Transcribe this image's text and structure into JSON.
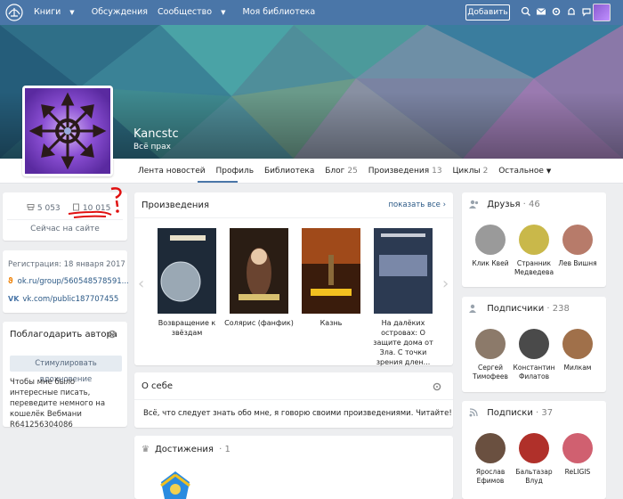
{
  "topbar": {
    "menu": [
      "Книги",
      "Обсуждения",
      "Сообщество",
      "Моя библиотека"
    ],
    "add_button": "Добавить",
    "icons": [
      "search-icon",
      "mail-icon",
      "settings-icon",
      "bell-icon",
      "chat-icon"
    ]
  },
  "profile": {
    "name": "Kancstc",
    "status": "Всё прах",
    "tabs": [
      {
        "label": "Лента новостей",
        "count": ""
      },
      {
        "label": "Профиль",
        "count": ""
      },
      {
        "label": "Библиотека",
        "count": ""
      },
      {
        "label": "Блог",
        "count": "25"
      },
      {
        "label": "Произведения",
        "count": "13"
      },
      {
        "label": "Циклы",
        "count": "2"
      },
      {
        "label": "Остальное",
        "count": ""
      }
    ]
  },
  "stats": {
    "likes": "5 053",
    "views": "10 015",
    "online": "Сейчас на сайте"
  },
  "info": {
    "registration": "Регистрация: 18 января 2017",
    "ok_link": "ok.ru/group/560548578591...",
    "vk_link": "vk.com/public187707455"
  },
  "thank": {
    "title": "Поблагодарить автора",
    "button": "Стимулировать вдохновение",
    "text": "Чтобы мне было интересные писать, переведите немного на кошелёк Вебмани R641256304086"
  },
  "works": {
    "title": "Произведения",
    "show_all": "показать все",
    "books": [
      {
        "caption": "Возвращение к звёздам",
        "cover_color": "#1e2a38"
      },
      {
        "caption": "Солярис (фанфик)",
        "cover_color": "#2a1d14"
      },
      {
        "caption": "Казнь",
        "cover_color": "#3a1c0c"
      },
      {
        "caption": "На далёких островах: О защите дома от Зла. С точки зрения длен...",
        "cover_color": "#2c3a52"
      }
    ]
  },
  "about": {
    "title": "О себе",
    "text": "Всё, что следует знать обо мне, я говорю своими произведениями. Читайте!"
  },
  "achievements": {
    "title": "Достижения",
    "count": "1"
  },
  "friends": {
    "title": "Друзья",
    "count": "46",
    "people": [
      {
        "name": "Клик Квей",
        "color": "#9a9a9a"
      },
      {
        "name": "Странник Медведева",
        "color": "#c9b84a"
      },
      {
        "name": "Лев Вишня",
        "color": "#b77b6a"
      }
    ]
  },
  "followers": {
    "title": "Подписчики",
    "count": "238",
    "people": [
      {
        "name": "Сергей Тимофеев",
        "color": "#8c7a6a"
      },
      {
        "name": "Константин Филатов",
        "color": "#4a4a4a"
      },
      {
        "name": "Милкам",
        "color": "#a0704a"
      }
    ]
  },
  "subscriptions": {
    "title": "Подписки",
    "count": "37",
    "people": [
      {
        "name": "Ярослав Ефимов",
        "color": "#6a5040"
      },
      {
        "name": "Бальтазар Влуд",
        "color": "#b0302a"
      },
      {
        "name": "ReLIGIS",
        "color": "#d06070"
      }
    ]
  }
}
